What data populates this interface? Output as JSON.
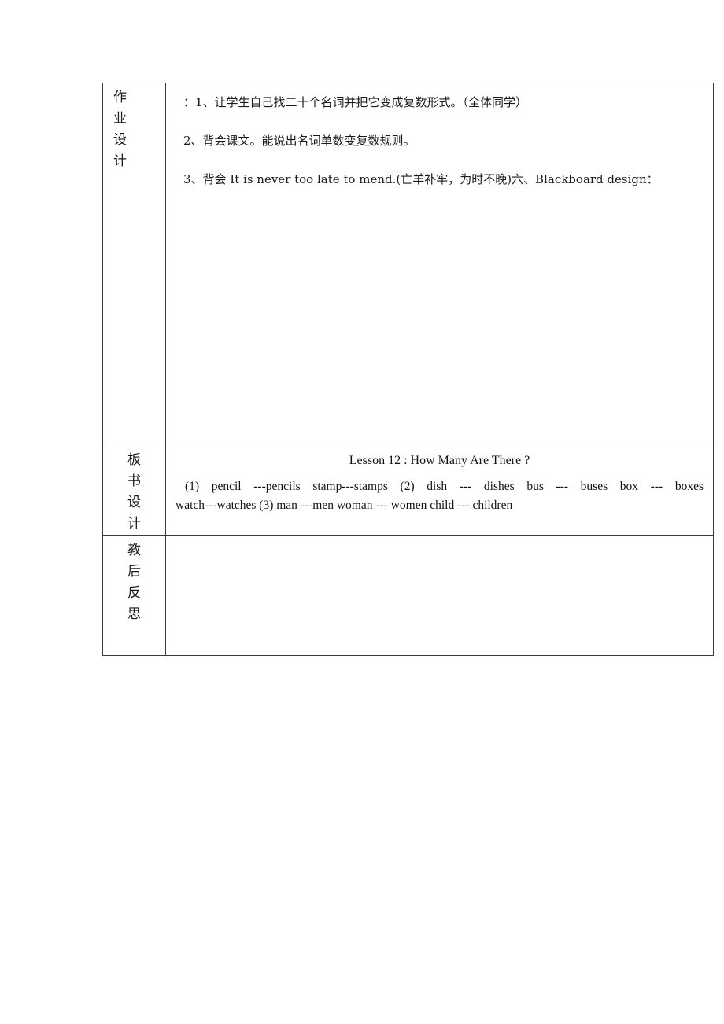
{
  "document": {
    "type": "lesson-plan-table",
    "rows": [
      {
        "label_chars": [
          "作",
          "业",
          "设",
          "计"
        ],
        "label_text": "作业设计",
        "lines": [
          "：1、让学生自己找二十个名词并把它变成复数形式。（全体同学）",
          "2、背会课文。能说出名词单数变复数规则。",
          "3、背会 It is never too late to mend.(亡羊补牢，为时不晚)六、Blackboard design："
        ]
      },
      {
        "label_chars": [
          "板",
          "书",
          "设",
          "计"
        ],
        "label_text": "板书设计",
        "title": "Lesson 12 : How Many Are There ?",
        "lines": [
          "(1)  pencil  ---pencils   stamp---stamps  (2)  dish  ---  dishes  bus  ---  buses    box  ---  boxes",
          "watch---watches  (3) man ---men woman --- women child --- children"
        ]
      },
      {
        "label_chars": [
          "教",
          "后",
          "反",
          "思"
        ],
        "label_text": "教后反思",
        "lines": []
      }
    ]
  },
  "style": {
    "border_color": "#3a3a3a",
    "text_color": "#1a1a1a",
    "background": "#ffffff"
  }
}
